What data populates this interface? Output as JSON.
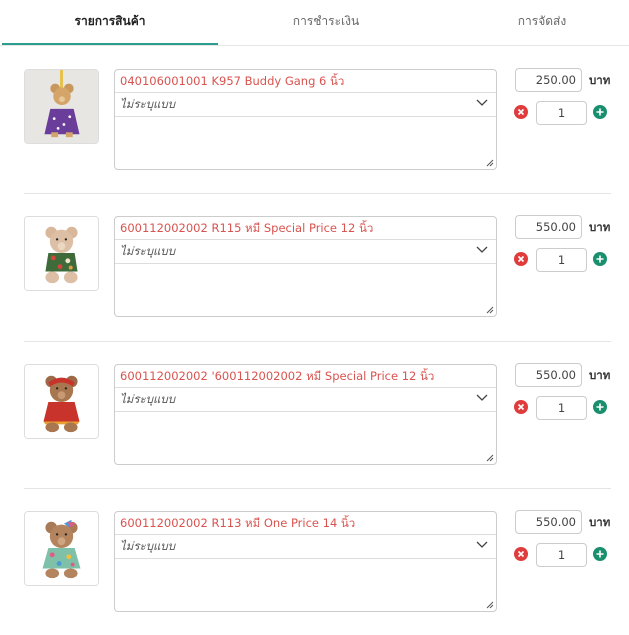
{
  "tabs": [
    {
      "label": "รายการสินค้า",
      "active": true
    },
    {
      "label": "การชำระเงิน",
      "active": false
    },
    {
      "label": "การจัดส่ง",
      "active": false
    }
  ],
  "currency_label": "บาท",
  "colors": {
    "accent": "#2a9d8f",
    "title": "#d9534f",
    "remove": "#e03c3c",
    "add": "#1a8f6e"
  },
  "items": [
    {
      "title": "040106001001 K957 Buddy Gang 6 นิ้ว",
      "variant": "ไม่ระบุแบบ",
      "price": "250.00",
      "qty": "1",
      "image": "teddy-bear-purple-dress-icon"
    },
    {
      "title": "600112002002 R115 หมี Special Price 12 นิ้ว",
      "variant": "ไม่ระบุแบบ",
      "price": "550.00",
      "qty": "1",
      "image": "teddy-bear-floral-shirt-icon"
    },
    {
      "title": "600112002002 '600112002002 หมี Special Price 12 นิ้ว",
      "variant": "ไม่ระบุแบบ",
      "price": "550.00",
      "qty": "1",
      "image": "teddy-bear-red-dress-icon"
    },
    {
      "title": "600112002002 R113 หมี One Price 14 นิ้ว",
      "variant": "ไม่ระบุแบบ",
      "price": "550.00",
      "qty": "1",
      "image": "teddy-bear-colorful-dress-icon"
    }
  ]
}
